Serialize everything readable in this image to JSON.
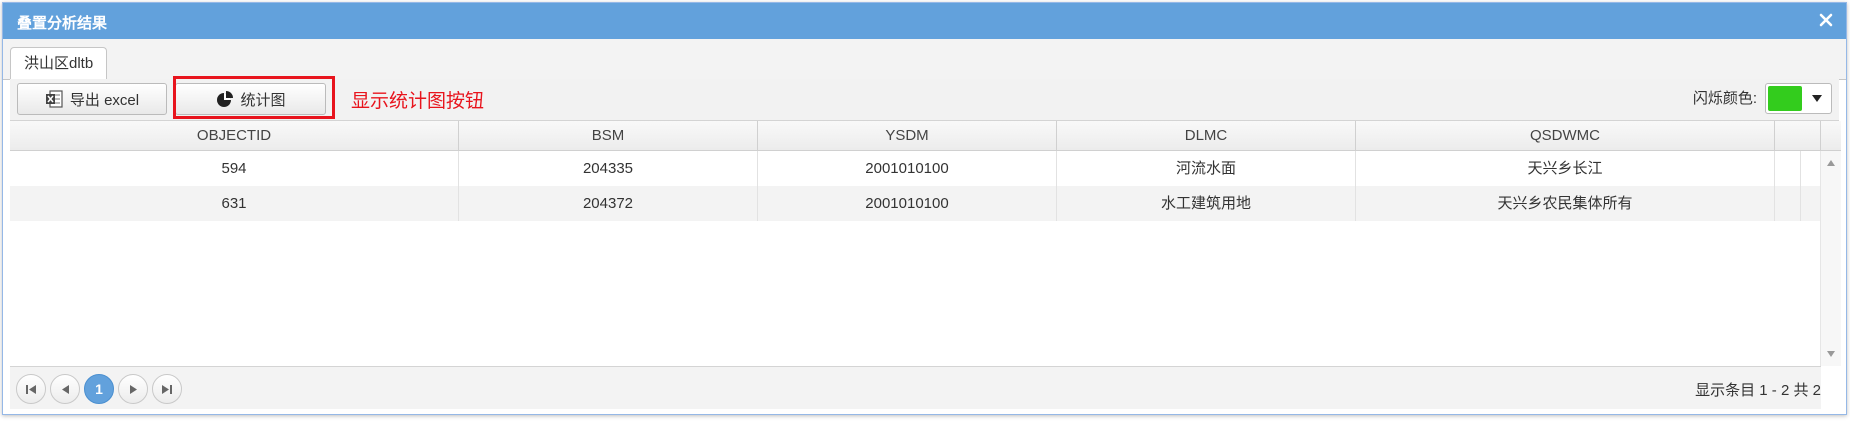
{
  "window": {
    "title": "叠置分析结果"
  },
  "tabs": [
    {
      "label": "洪山区dltb"
    }
  ],
  "toolbar": {
    "export_label": "导出 excel",
    "chart_label": "统计图",
    "annotation": "显示统计图按钮",
    "flash_label": "闪烁颜色:",
    "flash_color": "#33cc1d"
  },
  "table": {
    "columns": [
      "OBJECTID",
      "BSM",
      "YSDM",
      "DLMC",
      "QSDWMC"
    ],
    "rows": [
      [
        "594",
        "204335",
        "2001010100",
        "河流水面",
        "天兴乡长江"
      ],
      [
        "631",
        "204372",
        "2001010100",
        "水工建筑用地",
        "天兴乡农民集体所有"
      ]
    ]
  },
  "pager": {
    "current_page": "1",
    "info": "显示条目 1 - 2 共 2"
  },
  "colors": {
    "titlebar": "#62a1dc",
    "highlight": "#e8141d"
  }
}
